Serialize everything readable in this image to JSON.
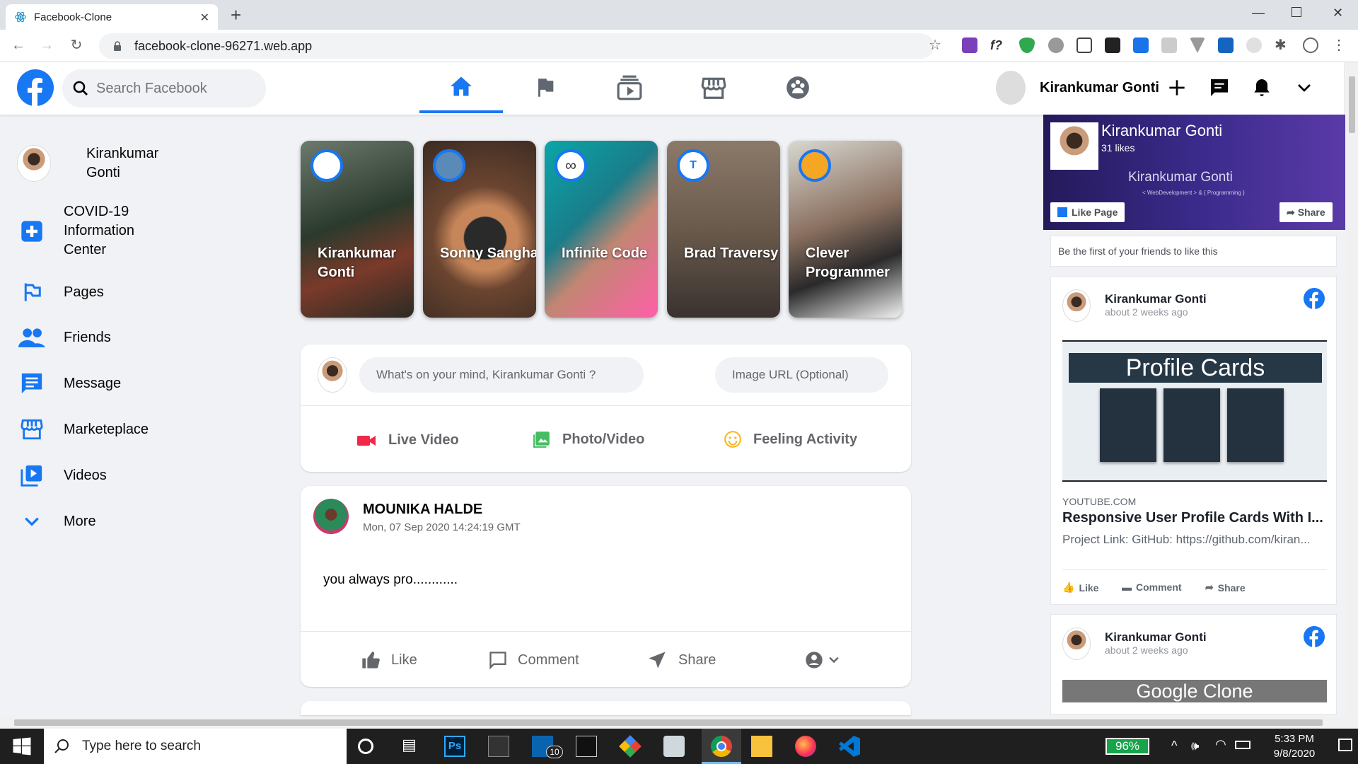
{
  "browser": {
    "tab_title": "Facebook-Clone",
    "url": "facebook-clone-96271.web.app"
  },
  "header": {
    "search_placeholder": "Search Facebook",
    "user_name": "Kirankumar Gonti"
  },
  "sidebar": {
    "items": [
      {
        "label": "Kirankumar Gonti"
      },
      {
        "label": "COVID-19 Information Center"
      },
      {
        "label": "Pages"
      },
      {
        "label": "Friends"
      },
      {
        "label": "Message"
      },
      {
        "label": "Marketeplace"
      },
      {
        "label": "Videos"
      },
      {
        "label": "More"
      }
    ]
  },
  "stories": [
    {
      "name": "Kirankumar Gonti"
    },
    {
      "name": "Sonny Sangha"
    },
    {
      "name": "Infinite Code"
    },
    {
      "name": "Brad Traversy"
    },
    {
      "name": "Clever Programmer"
    }
  ],
  "composer": {
    "placeholder": "What's on your mind, Kirankumar Gonti ?",
    "image_placeholder": "Image URL (Optional)",
    "actions": [
      {
        "label": "Live Video"
      },
      {
        "label": "Photo/Video"
      },
      {
        "label": "Feeling Activity"
      }
    ]
  },
  "post": {
    "author": "MOUNIKA HALDE",
    "timestamp": "Mon, 07 Sep 2020 14:24:19 GMT",
    "text": "you always pro............",
    "actions": [
      {
        "label": "Like"
      },
      {
        "label": "Comment"
      },
      {
        "label": "Share"
      }
    ]
  },
  "page_widget": {
    "name": "Kirankumar Gonti",
    "likes": "31 likes",
    "banner_text": "Kirankumar Gonti",
    "banner_sub": "< WebDevelopment > & { Programming }",
    "like_page": "Like Page",
    "share": "Share",
    "friends_note": "Be the first of your friends to like this"
  },
  "feed_posts": [
    {
      "author": "Kirankumar Gonti",
      "time": "about 2 weeks ago",
      "image_title": "Profile Cards",
      "source": "YOUTUBE.COM",
      "link_title": "Responsive User Profile Cards With I...",
      "link_desc": "Project Link: GitHub: https://github.com/kiran...",
      "actions": [
        {
          "label": "Like"
        },
        {
          "label": "Comment"
        },
        {
          "label": "Share"
        }
      ]
    },
    {
      "author": "Kirankumar Gonti",
      "time": "about 2 weeks ago",
      "image_title": "Google Clone"
    }
  ],
  "taskbar": {
    "search_placeholder": "Type here to search",
    "battery": "96%",
    "mail_badge": "10",
    "time": "5:33 PM",
    "date": "9/8/2020"
  },
  "colors": {
    "brand": "#1877f2",
    "background": "#f0f2f5"
  }
}
